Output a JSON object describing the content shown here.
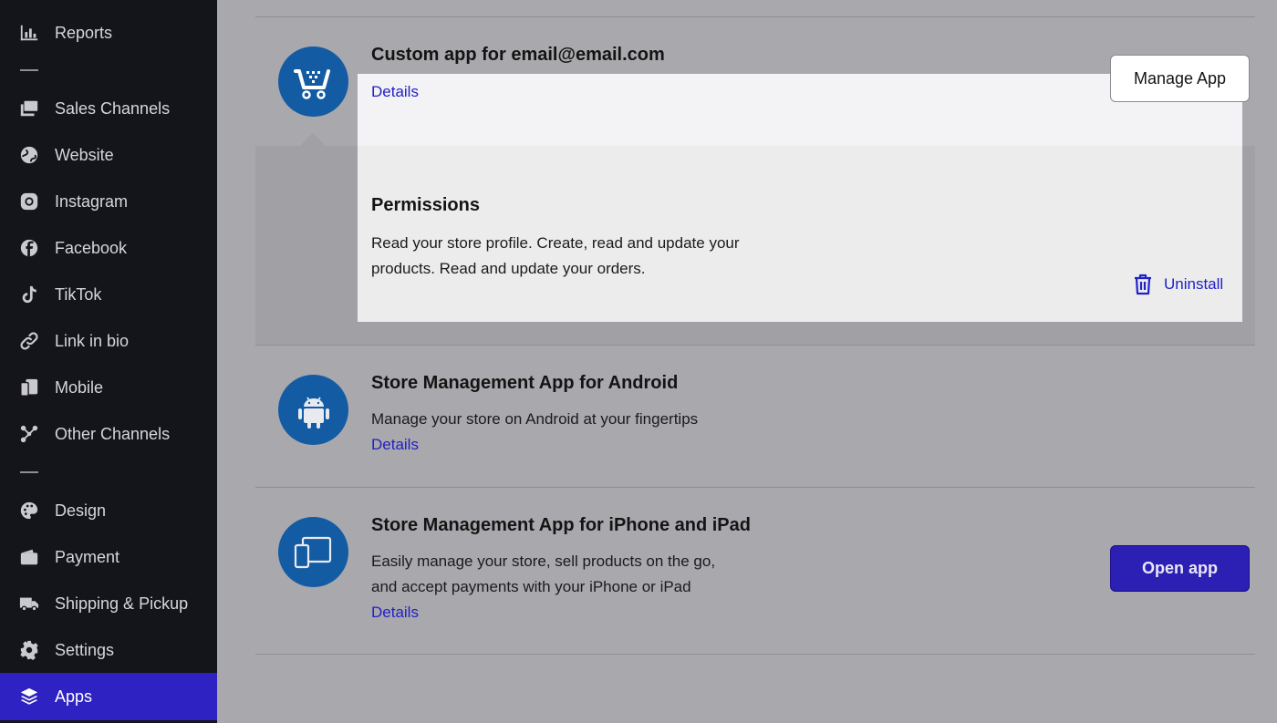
{
  "sidebar": {
    "items": [
      {
        "label": "Reports",
        "icon": "bar-chart-icon"
      },
      {
        "label": "Sales Channels",
        "icon": "channels-icon"
      },
      {
        "label": "Website",
        "icon": "globe-icon"
      },
      {
        "label": "Instagram",
        "icon": "instagram-icon"
      },
      {
        "label": "Facebook",
        "icon": "facebook-icon"
      },
      {
        "label": "TikTok",
        "icon": "tiktok-icon"
      },
      {
        "label": "Link in bio",
        "icon": "link-icon"
      },
      {
        "label": "Mobile",
        "icon": "mobile-icon"
      },
      {
        "label": "Other Channels",
        "icon": "share-icon"
      },
      {
        "label": "Design",
        "icon": "palette-icon"
      },
      {
        "label": "Payment",
        "icon": "wallet-icon"
      },
      {
        "label": "Shipping & Pickup",
        "icon": "truck-icon"
      },
      {
        "label": "Settings",
        "icon": "gear-icon"
      },
      {
        "label": "Apps",
        "icon": "layers-icon",
        "active": true
      }
    ],
    "active_color": "#2f22c2"
  },
  "apps": [
    {
      "title": "Custom app for email@email.com",
      "details_label": "Details",
      "button_label": "Manage App",
      "icon": "shopping-cart-icon",
      "permissions": {
        "title": "Permissions",
        "text": "Read your store profile. Create, read and update your products. Read and update your orders."
      },
      "uninstall_label": "Uninstall"
    },
    {
      "title": "Store Management App for Android",
      "description": "Manage your store on Android at your fingertips",
      "details_label": "Details",
      "icon": "android-icon"
    },
    {
      "title": "Store Management App for iPhone and iPad",
      "description_line1": "Easily manage your store, sell products on the go,",
      "description_line2": "and accept payments with your iPhone or iPad",
      "details_label": "Details",
      "button_label": "Open app",
      "icon": "devices-icon"
    }
  ],
  "colors": {
    "link": "#2121c8",
    "primary_button": "#2c1fb3",
    "app_icon_bg": "#135ca3"
  }
}
